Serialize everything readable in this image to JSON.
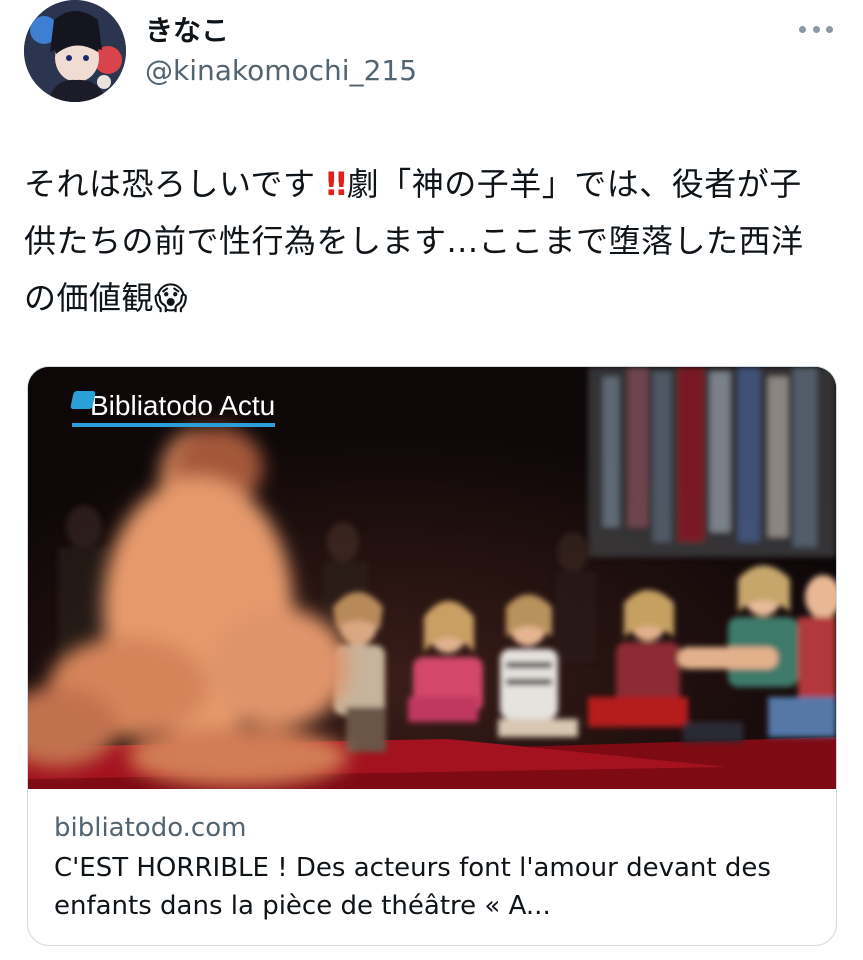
{
  "user": {
    "display_name": "きなこ",
    "handle": "@kinakomochi_215",
    "avatar": "anime-character-avatar"
  },
  "menu": {
    "icon": "more-horizontal-icon"
  },
  "tweet": {
    "text_before": "それは恐ろしいです",
    "text_mid": "劇「神の子羊」では、役者が子供たちの前で性行為をします...ここまで堕落した西洋の価値観",
    "emoji_alert": "‼",
    "emoji_scream": "😱"
  },
  "card": {
    "image": "theater-stage-photo",
    "watermark": "Bibliatodo Actu",
    "domain": "bibliatodo.com",
    "title": "C'EST HORRIBLE ! Des acteurs font l'amour devant des enfants dans la pièce de théâtre « A..."
  },
  "colors": {
    "name": "#0f1419",
    "handle": "#536471",
    "border": "#cfd9de",
    "alert": "#e0201b",
    "watermark_accent": "#2a9fd8"
  }
}
